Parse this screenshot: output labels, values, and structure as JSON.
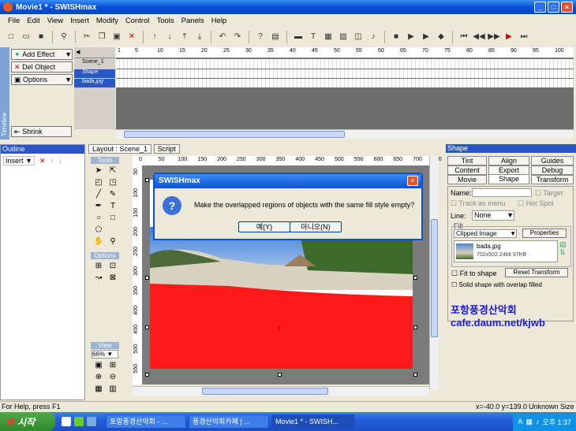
{
  "window": {
    "title": "Movie1 * - SWISHmax"
  },
  "menu": [
    "File",
    "Edit",
    "View",
    "Insert",
    "Modify",
    "Control",
    "Tools",
    "Panels",
    "Help"
  ],
  "effects": {
    "add_effect": "Add Effect",
    "del_object": "Del Object",
    "options": "Options",
    "shrink": "Shrink",
    "vertical_label": "Timeline"
  },
  "timeline": {
    "ruler": [
      "1",
      "5",
      "10",
      "15",
      "20",
      "25",
      "30",
      "35",
      "40",
      "45",
      "50",
      "55",
      "60",
      "65",
      "70",
      "75",
      "80",
      "85",
      "90",
      "95",
      "100"
    ],
    "rows": [
      "Scene_1",
      "Shape",
      "bada.jpg"
    ]
  },
  "outline": {
    "title": "Outline",
    "insert_label": "Insert"
  },
  "layout": {
    "tabs": [
      "Layout : Scene_1",
      "Script"
    ],
    "ruler": [
      "0",
      "50",
      "100",
      "150",
      "200",
      "250",
      "300",
      "350",
      "400",
      "450",
      "500",
      "550",
      "600",
      "650",
      "700",
      "750"
    ],
    "vruler": [
      "50",
      "100",
      "150",
      "200",
      "250",
      "300",
      "350",
      "400",
      "450",
      "500",
      "550"
    ],
    "tools_title": "Tools",
    "options_title": "Options",
    "view_title": "View",
    "zoom": "66%"
  },
  "dialog": {
    "title": "SWISHmax",
    "message": "Make the overlapped regions of objects with the same fill style empty?",
    "yes": "예(Y)",
    "no": "아니오(N)"
  },
  "shape_panel": {
    "title": "Shape",
    "tabs_row1": [
      "Tint",
      "Align",
      "Guides"
    ],
    "tabs_row2": [
      "Content",
      "Export",
      "Debug"
    ],
    "tabs_row3": [
      "Movie",
      "Shape",
      "Transform"
    ],
    "name_label": "Name:",
    "target_label": "Target",
    "track_as_menu": "Track as menu",
    "hot_spot": "Hot Spot",
    "line_label": "Line:",
    "line_value": "None",
    "fill_label": "Fill",
    "fill_type": "Clipped Image",
    "properties_btn": "Properties",
    "image_name": "bada.jpg",
    "image_info": "702x502 24bit 97KB",
    "fit_to_shape": "Fit to shape",
    "reset_transform": "Reset Transform",
    "solid_shape": "Solid shape with overlap filled"
  },
  "watermark": {
    "line1": "포항풍경산악회",
    "line2": "cafe.daum.net/kjwb"
  },
  "status": {
    "help": "For Help, press F1",
    "coords": "x=-40.0 y=139.0",
    "size": "Unknown Size"
  },
  "taskbar": {
    "start": "시작",
    "items": [
      "포항풍경산악회 - ...",
      "풍경산악회카페 | ...",
      "Movie1 * - SWISH..."
    ],
    "tray_lang": "A",
    "clock": "오후 1:37"
  },
  "colors": {
    "accent": "#0a4fd8",
    "red_shape": "#ff1a1a",
    "selection": "#2b55c4"
  }
}
